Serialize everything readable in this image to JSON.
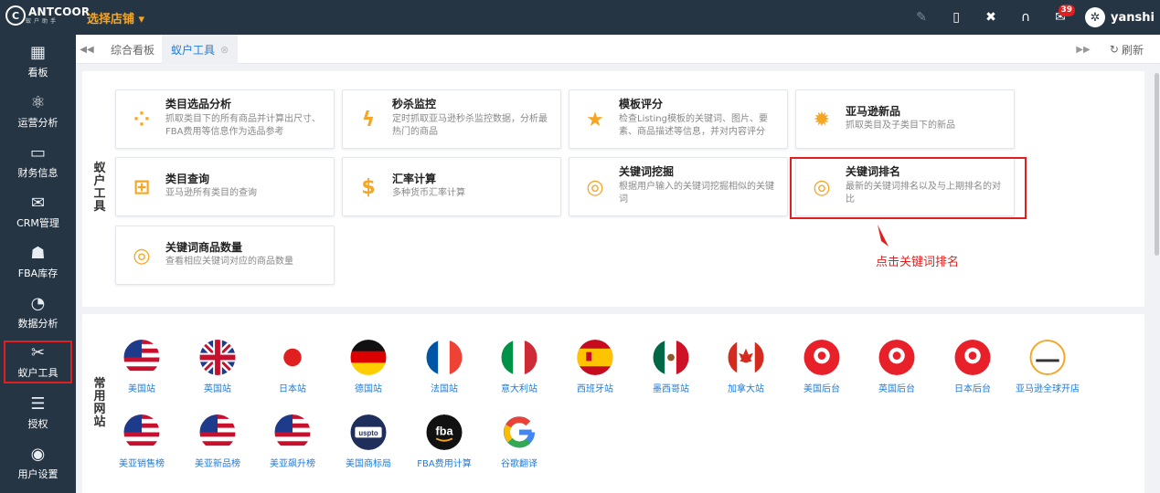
{
  "topbar": {
    "logo_text": "ANTCOOR",
    "logo_sub": "蚁户助手",
    "store_select": "选择店铺 ▾",
    "mail_badge": "39",
    "username": "yanshi"
  },
  "sidebar": {
    "items": [
      {
        "label": "看板",
        "icon": "dashboard-icon"
      },
      {
        "label": "运营分析",
        "icon": "analysis-icon"
      },
      {
        "label": "财务信息",
        "icon": "finance-icon"
      },
      {
        "label": "CRM管理",
        "icon": "crm-icon"
      },
      {
        "label": "FBA库存",
        "icon": "inventory-icon"
      },
      {
        "label": "数据分析",
        "icon": "chart-icon"
      },
      {
        "label": "蚁户工具",
        "icon": "tools-icon"
      },
      {
        "label": "授权",
        "icon": "auth-icon"
      },
      {
        "label": "用户设置",
        "icon": "user-settings-icon"
      }
    ]
  },
  "tabs": {
    "items": [
      {
        "label": "综合看板"
      },
      {
        "label": "蚁户工具"
      }
    ],
    "refresh": "刷新"
  },
  "tools_section": {
    "label_chars": [
      "蚁",
      "户",
      "工",
      "具"
    ],
    "cards": [
      {
        "title": "类目选品分析",
        "desc": "抓取类目下的所有商品并计算出尺寸、FBA费用等信息作为选品参考"
      },
      {
        "title": "秒杀监控",
        "desc": "定时抓取亚马逊秒杀监控数据，分析最热门的商品"
      },
      {
        "title": "模板评分",
        "desc": "检查Listing模板的关键词、图片、要素、商品描述等信息，并对内容评分"
      },
      {
        "title": "亚马逊新品",
        "desc": "抓取类目及子类目下的新品"
      },
      {
        "title": "类目查询",
        "desc": "亚马逊所有类目的查询"
      },
      {
        "title": "汇率计算",
        "desc": "多种货币汇率计算"
      },
      {
        "title": "关键词挖掘",
        "desc": "根据用户输入的关键词挖掘相似的关键词"
      },
      {
        "title": "关键词排名",
        "desc": "最新的关键词排名以及与上期排名的对比"
      },
      {
        "title": "关键词商品数量",
        "desc": "查看相应关键词对应的商品数量"
      }
    ],
    "annotation": "点击关键词排名"
  },
  "sites_section": {
    "label_chars": [
      "常",
      "用",
      "网",
      "站"
    ],
    "sites": [
      {
        "label": "美国站"
      },
      {
        "label": "英国站"
      },
      {
        "label": "日本站"
      },
      {
        "label": "德国站"
      },
      {
        "label": "法国站"
      },
      {
        "label": "意大利站"
      },
      {
        "label": "西班牙站"
      },
      {
        "label": "墨西哥站"
      },
      {
        "label": "加拿大站"
      },
      {
        "label": "美国后台"
      },
      {
        "label": "英国后台"
      },
      {
        "label": "日本后台"
      },
      {
        "label": "亚马逊全球开店"
      },
      {
        "label": "美亚销售榜"
      },
      {
        "label": "美亚新品榜"
      },
      {
        "label": "美亚飙升榜"
      },
      {
        "label": "美国商标局"
      },
      {
        "label": "FBA费用计算"
      },
      {
        "label": "谷歌翻译"
      }
    ],
    "uspto_text": "uspto",
    "fba_text": "fba",
    "global_store_text": "全球开店"
  }
}
